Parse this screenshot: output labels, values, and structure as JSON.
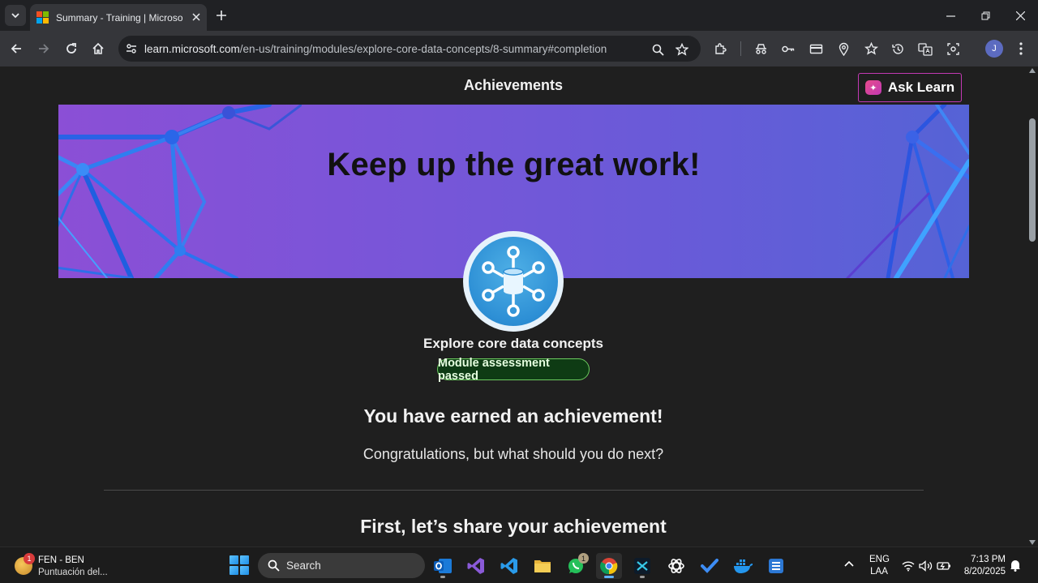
{
  "browser": {
    "tab_title": "Summary - Training | Microsoft Learn",
    "url_host": "learn.microsoft.com",
    "url_path": "/en-us/training/modules/explore-core-data-concepts/8-summary#completion",
    "profile_initial": "J"
  },
  "page": {
    "achievements_heading": "Achievements",
    "ask_learn_label": "Ask Learn",
    "banner_title": "Keep up the great work!",
    "module_name": "Explore core data concepts",
    "status_badge": "Module assessment passed",
    "earned_heading": "You have earned an achievement!",
    "congrats_text": "Congratulations, but what should you do next?",
    "share_heading": "First, let’s share your achievement"
  },
  "taskbar": {
    "weather_badge": "1",
    "weather_line1": "FEN - BEN",
    "weather_line2": "Puntuación del...",
    "search_label": "Search",
    "whatsapp_badge": "1",
    "lang_line1": "ENG",
    "lang_line2": "LAA",
    "time": "7:13 PM",
    "date": "8/20/2025"
  },
  "colors": {
    "accent_magenta": "#c239b3",
    "success_green": "#6ccb5f",
    "banner_purple": "#7a55d8",
    "page_bg": "#1f1f1f"
  }
}
